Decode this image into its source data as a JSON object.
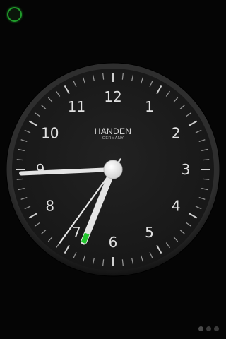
{
  "status_indicator": {
    "icon": "ring-indicator-icon",
    "color": "#1f9a2a"
  },
  "clock": {
    "brand": "HANDEN",
    "brand_sub": "GERMANY",
    "numerals": [
      "12",
      "1",
      "2",
      "3",
      "4",
      "5",
      "6",
      "7",
      "8",
      "9",
      "10",
      "11"
    ],
    "time": {
      "hour": 6,
      "minute": 44,
      "second": 36
    },
    "colors": {
      "face": "#1a1a1a",
      "bezel": "#2a2a2a",
      "hands": "#e4e4e4",
      "second_hand": "#e4e4e4",
      "accent": "#23c62e"
    }
  },
  "page_indicator": {
    "count": 3,
    "active": 0
  }
}
